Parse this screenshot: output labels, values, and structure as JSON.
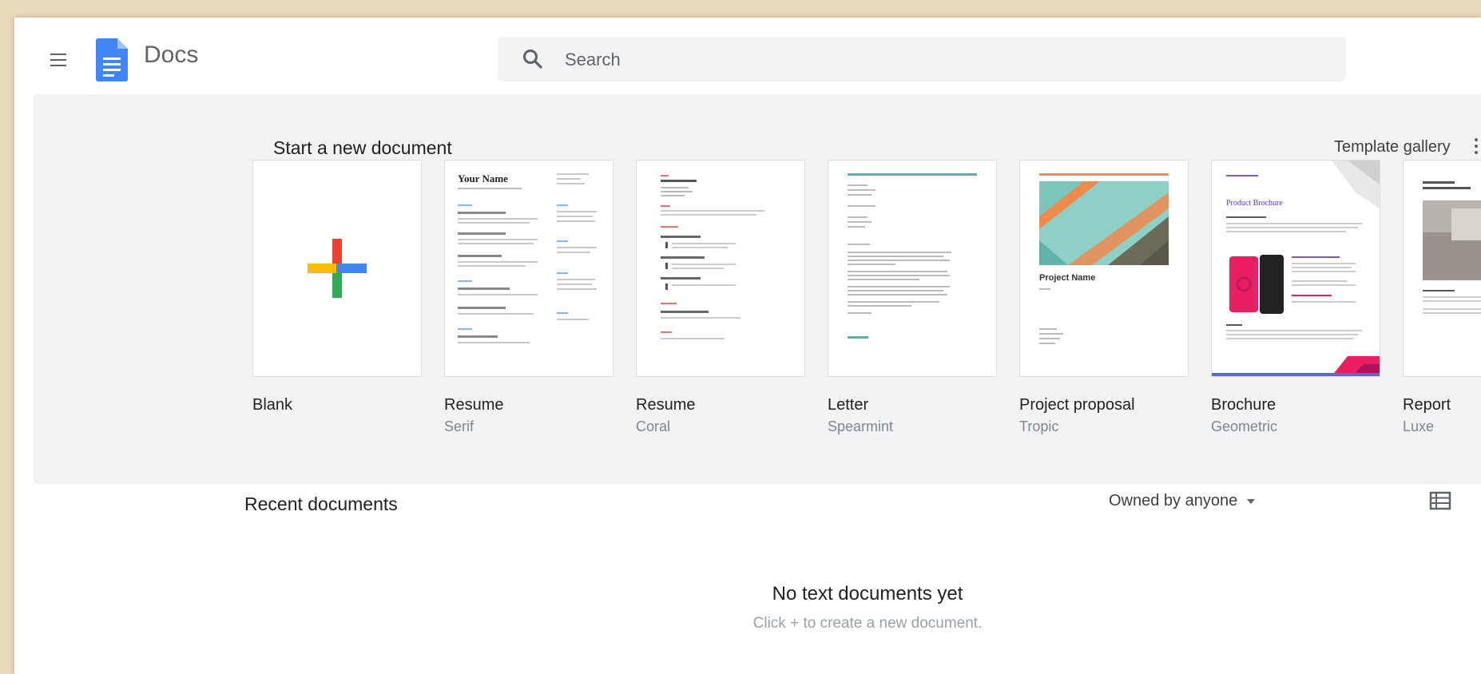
{
  "header": {
    "menu_icon": "hamburger-menu-icon",
    "logo_icon": "google-docs-logo-icon",
    "app_title": "Docs",
    "search": {
      "icon": "search-icon",
      "placeholder": "Search"
    }
  },
  "templates": {
    "title": "Start a new document",
    "gallery_label": "Template gallery",
    "more_icon": "more-vert-icon",
    "items": [
      {
        "name": "Blank",
        "subtitle": ""
      },
      {
        "name": "Resume",
        "subtitle": "Serif",
        "preview_heading": "Your Name"
      },
      {
        "name": "Resume",
        "subtitle": "Coral"
      },
      {
        "name": "Letter",
        "subtitle": "Spearmint"
      },
      {
        "name": "Project proposal",
        "subtitle": "Tropic",
        "preview_heading": "Project Name"
      },
      {
        "name": "Brochure",
        "subtitle": "Geometric",
        "preview_heading": "Product Brochure"
      },
      {
        "name": "Report",
        "subtitle": "Luxe"
      }
    ]
  },
  "recent": {
    "title": "Recent documents",
    "owner_filter": "Owned by anyone",
    "view_icon": "list-view-icon",
    "empty_title": "No text documents yet",
    "empty_subtitle": "Click + to create a new document."
  },
  "colors": {
    "google_blue": "#4285F4",
    "google_red": "#EA4335",
    "google_yellow": "#FBBC04",
    "google_green": "#34A853",
    "strip_bg": "#f1f3f4"
  }
}
